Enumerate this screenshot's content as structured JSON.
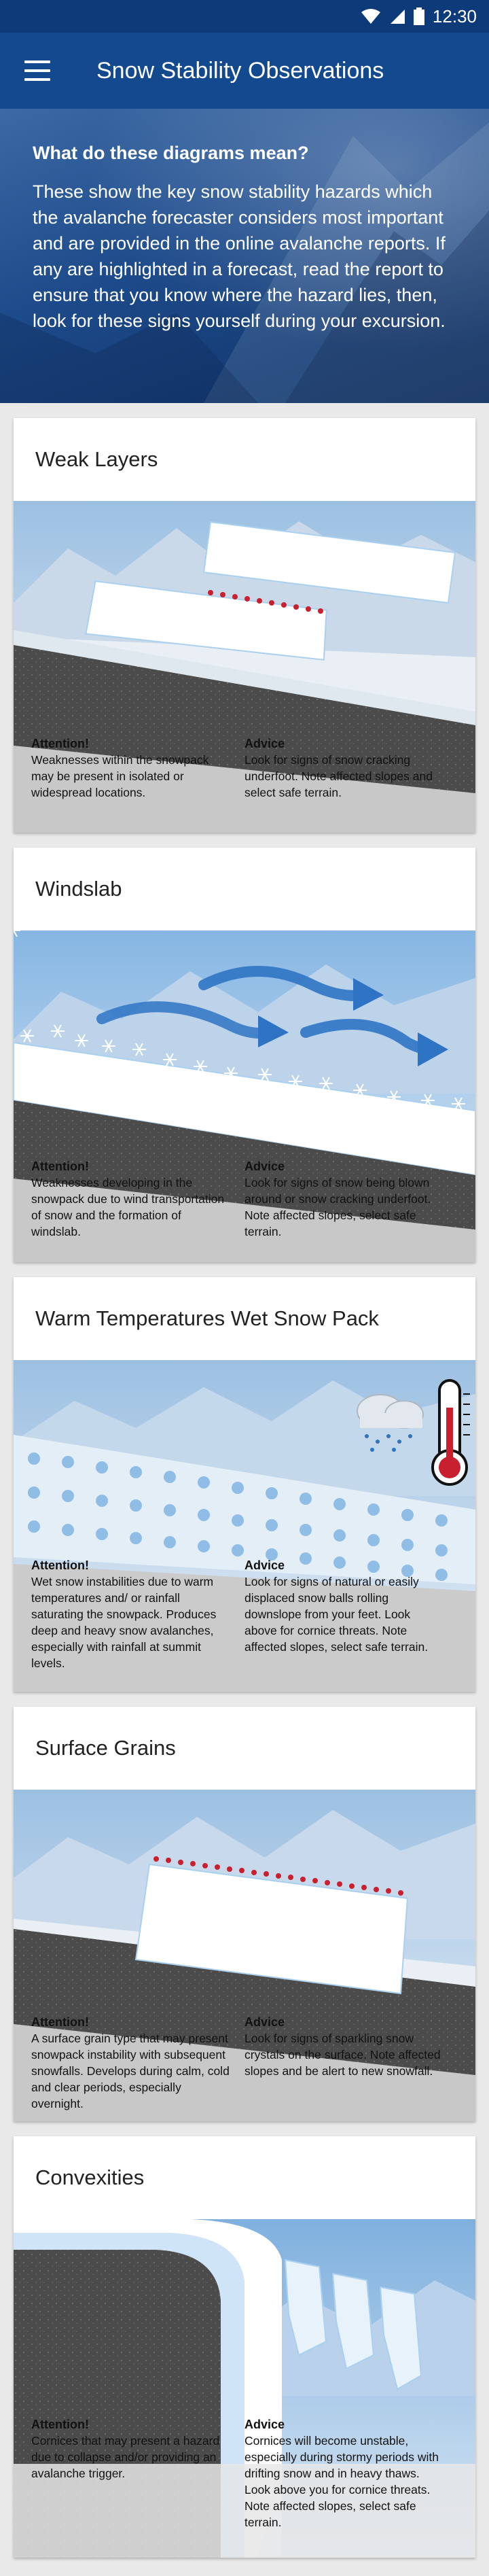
{
  "status": {
    "time": "12:30"
  },
  "appbar": {
    "title": "Snow Stability Observations"
  },
  "intro": {
    "heading": "What do these diagrams mean?",
    "body": "These show the key snow stability hazards which the avalanche forecaster considers most important and are provided in the online avalanche reports. If any are highlighted in a forecast, read the report to ensure that you know where the hazard lies, then, look for these signs yourself during your excursion."
  },
  "cards": [
    {
      "title": "Weak Layers",
      "attention_label": "Attention!",
      "attention": "Weaknesses within the snowpack may be present in isolated or widespread locations.",
      "advice_label": "Advice",
      "advice": "Look for signs of snow cracking underfoot. Note affected slopes and select safe terrain."
    },
    {
      "title": "Windslab",
      "attention_label": "Attention!",
      "attention": "Weaknesses developing in the snowpack due to wind transportation of snow and the formation of windslab.",
      "advice_label": "Advice",
      "advice": "Look for signs of snow being blown around or snow cracking underfoot. Note affected slopes, select safe terrain."
    },
    {
      "title": "Warm Temperatures Wet Snow Pack",
      "attention_label": "Attention!",
      "attention": "Wet snow instabilities due to warm temperatures and/ or rainfall saturating the snowpack. Produces deep and heavy snow avalanches, especially with rainfall at summit levels.",
      "advice_label": "Advice",
      "advice": "Look for signs of natural or easily displaced snow balls rolling downslope from your feet. Look above for cornice threats. Note affected slopes, select safe terrain."
    },
    {
      "title": "Surface Grains",
      "attention_label": "Attention!",
      "attention": "A surface grain type that may present snowpack instability with subsequent snowfalls. Develops during calm, cold and clear periods, especially overnight.",
      "advice_label": "Advice",
      "advice": "Look for signs of sparkling snow crystals on the surface. Note affected slopes and be alert to new snowfall."
    },
    {
      "title": "Convexities",
      "attention_label": "Attention!",
      "attention": "Cornices that may present a hazard due to collapse and/or providing an avalanche trigger.",
      "advice_label": "Advice",
      "advice": "Cornices will become unstable, especially during stormy periods with drifting snow and in heavy thaws. Look above you for cornice threats. Note affected slopes, select safe terrain."
    }
  ],
  "colors": {
    "appbar": "#13498f",
    "statusbar": "#0d3a78",
    "hazard_dots": "#c8202f",
    "rock": "#4a4a4a"
  }
}
